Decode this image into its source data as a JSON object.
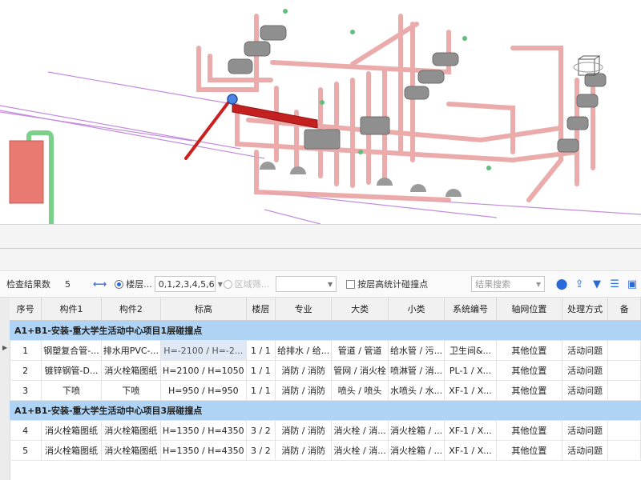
{
  "toolbar": {
    "result_label": "检查结果数",
    "result_count": "5",
    "floor_radio_label": "楼层...",
    "floor_select_value": "0,1,2,3,4,5,6",
    "area_radio_label": "区域筛...",
    "stat_checkbox_label": "按层高统计碰撞点",
    "search_placeholder": "结果搜索"
  },
  "table": {
    "columns": [
      "序号",
      "构件1",
      "构件2",
      "标高",
      "楼层",
      "专业",
      "大类",
      "小类",
      "系统编号",
      "轴网位置",
      "处理方式",
      "备"
    ],
    "groups": [
      {
        "title": "A1+B1-安装-重大学生活动中心项目1层碰撞点",
        "rows": [
          {
            "no": "1",
            "c1": "钢塑复合管-...",
            "c2": "排水用PVC-...",
            "elev": "H=-2100 / H=-2...",
            "floor": "1 / 1",
            "major": "给排水 / 给...",
            "cat": "管道 / 管道",
            "sub": "给水管 / 污...",
            "sys": "卫生间&...",
            "axis": "其他位置",
            "handle": "活动问题"
          },
          {
            "no": "2",
            "c1": "镀锌钢管-D...",
            "c2": "消火栓箱图纸",
            "elev": "H=2100 / H=1050",
            "floor": "1 / 1",
            "major": "消防 / 消防",
            "cat": "管网 / 消火栓",
            "sub": "喷淋管 / 消...",
            "sys": "PL-1 / X...",
            "axis": "其他位置",
            "handle": "活动问题"
          },
          {
            "no": "3",
            "c1": "下喷",
            "c2": "下喷",
            "elev": "H=950 / H=950",
            "floor": "1 / 1",
            "major": "消防 / 消防",
            "cat": "喷头 / 喷头",
            "sub": "水喷头 / 水...",
            "sys": "XF-1 / X...",
            "axis": "其他位置",
            "handle": "活动问题"
          }
        ]
      },
      {
        "title": "A1+B1-安装-重大学生活动中心项目3层碰撞点",
        "rows": [
          {
            "no": "4",
            "c1": "消火栓箱图纸",
            "c2": "消火栓箱图纸",
            "elev": "H=1350 / H=4350",
            "floor": "3 / 2",
            "major": "消防 / 消防",
            "cat": "消火栓 / 消...",
            "sub": "消火栓箱 / ...",
            "sys": "XF-1 / X...",
            "axis": "其他位置",
            "handle": "活动问题"
          },
          {
            "no": "5",
            "c1": "消火栓箱图纸",
            "c2": "消火栓箱图纸",
            "elev": "H=1350 / H=4350",
            "floor": "3 / 2",
            "major": "消防 / 消防",
            "cat": "消火栓 / 消...",
            "sub": "消火栓箱 / ...",
            "sys": "XF-1 / X...",
            "axis": "其他位置",
            "handle": "活动问题"
          }
        ]
      }
    ]
  },
  "icons": [
    "link-icon",
    "location-pin-icon",
    "export-icon",
    "filter-icon",
    "list-icon",
    "save-icon"
  ],
  "colors": {
    "pipe": "#e8a0a0",
    "clash": "#cc1f1f",
    "group_bg": "#aed3f4",
    "accent": "#2a6ad8",
    "purple_line": "#b978d8",
    "green_pipe": "#7bd18a"
  }
}
